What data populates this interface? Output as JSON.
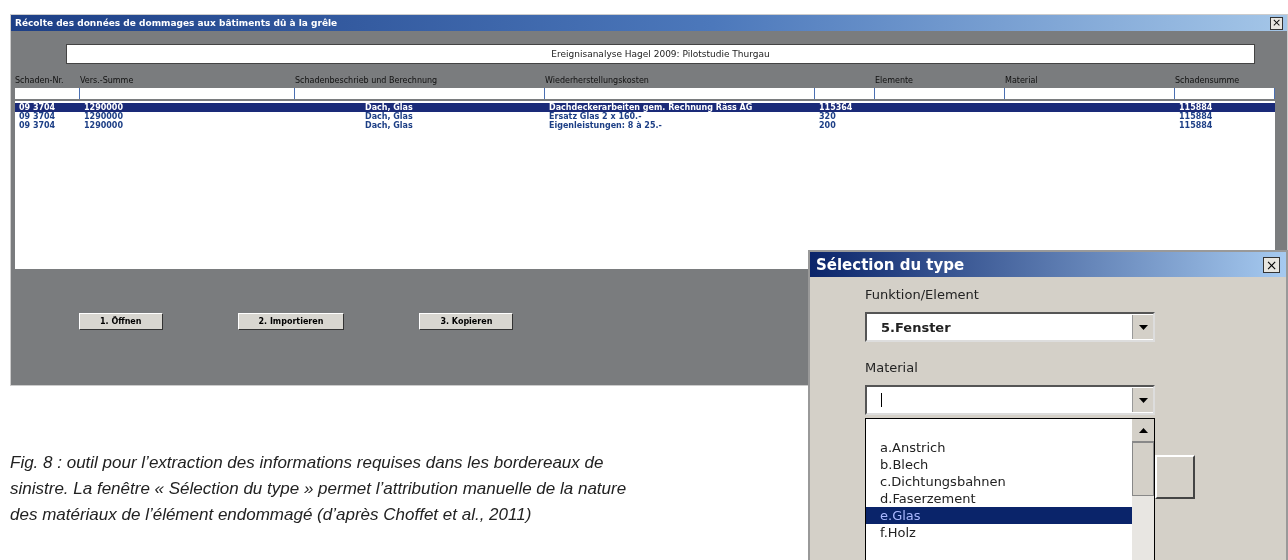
{
  "main_window": {
    "title": "Récolte des données de dommages aux bâtiments dû à la grêle",
    "close": "×",
    "heading": "Ereignisanalyse Hagel 2009: Pilotstudie Thurgau",
    "table": {
      "columns": [
        "Schaden-Nr.",
        "Vers.-Summe",
        "Schadenbeschrieb und Berechnung",
        "Wiederherstellungskosten",
        "Elemente",
        "Material",
        "Schadensumme"
      ],
      "rows": [
        {
          "selected": true,
          "schaden_nr": "09 3704",
          "vers_summe": "1290000",
          "schadenbeschrieb": "Dach, Glas",
          "wiederherstellungskosten": "Dachdeckerarbeiten gem. Rechnung Räss AG",
          "column_5": "115364",
          "schadensumme": "115884"
        },
        {
          "selected": false,
          "schaden_nr": "09 3704",
          "vers_summe": "1290000",
          "schadenbeschrieb": "Dach, Glas",
          "wiederherstellungskosten": "Ersatz Glas 2 x 160.-",
          "column_5": "320",
          "schadensumme": "115884"
        },
        {
          "selected": false,
          "schaden_nr": "09 3704",
          "vers_summe": "1290000",
          "schadenbeschrieb": "Dach, Glas",
          "wiederherstellungskosten": "Eigenleistungen: 8 à 25.-",
          "column_5": "200",
          "schadensumme": "115884"
        }
      ]
    },
    "buttons": [
      "1. Öffnen",
      "2. Importieren",
      "3. Kopieren"
    ]
  },
  "dialog": {
    "title": "Sélection du type",
    "close": "×",
    "funktion_label": "Funktion/Element",
    "funktion_value": "5.Fenster",
    "material_label": "Material",
    "material_options": [
      {
        "label": "a.Anstrich",
        "selected": false
      },
      {
        "label": "b.Blech",
        "selected": false
      },
      {
        "label": "c.Dichtungsbahnen",
        "selected": false
      },
      {
        "label": "d.Faserzement",
        "selected": false
      },
      {
        "label": "e.Glas",
        "selected": true
      },
      {
        "label": "f.Holz",
        "selected": false
      }
    ]
  },
  "caption": "Fig. 8 : outil pour l’extraction des informations requises dans les bordereaux de sinistre. La fenêtre « Sélection du type » permet l’attribution manuelle de la nature des matériaux de l’élément endommagé (d’après Choffet et al., 2011)"
}
